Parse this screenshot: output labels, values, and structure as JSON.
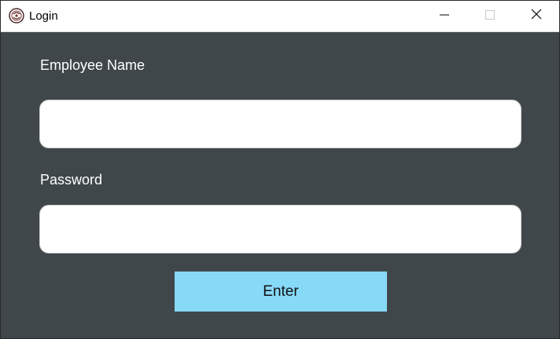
{
  "window": {
    "title": "Login",
    "app_icon": "app-logo-icon",
    "controls": [
      "minimize-icon",
      "maximize-icon",
      "close-icon"
    ]
  },
  "form": {
    "employee_name_label": "Employee Name",
    "employee_name_value": "",
    "password_label": "Password",
    "password_value": "",
    "enter_label": "Enter"
  },
  "colors": {
    "background": "#40474a",
    "button": "#87d9f8",
    "field": "#ffffff"
  }
}
